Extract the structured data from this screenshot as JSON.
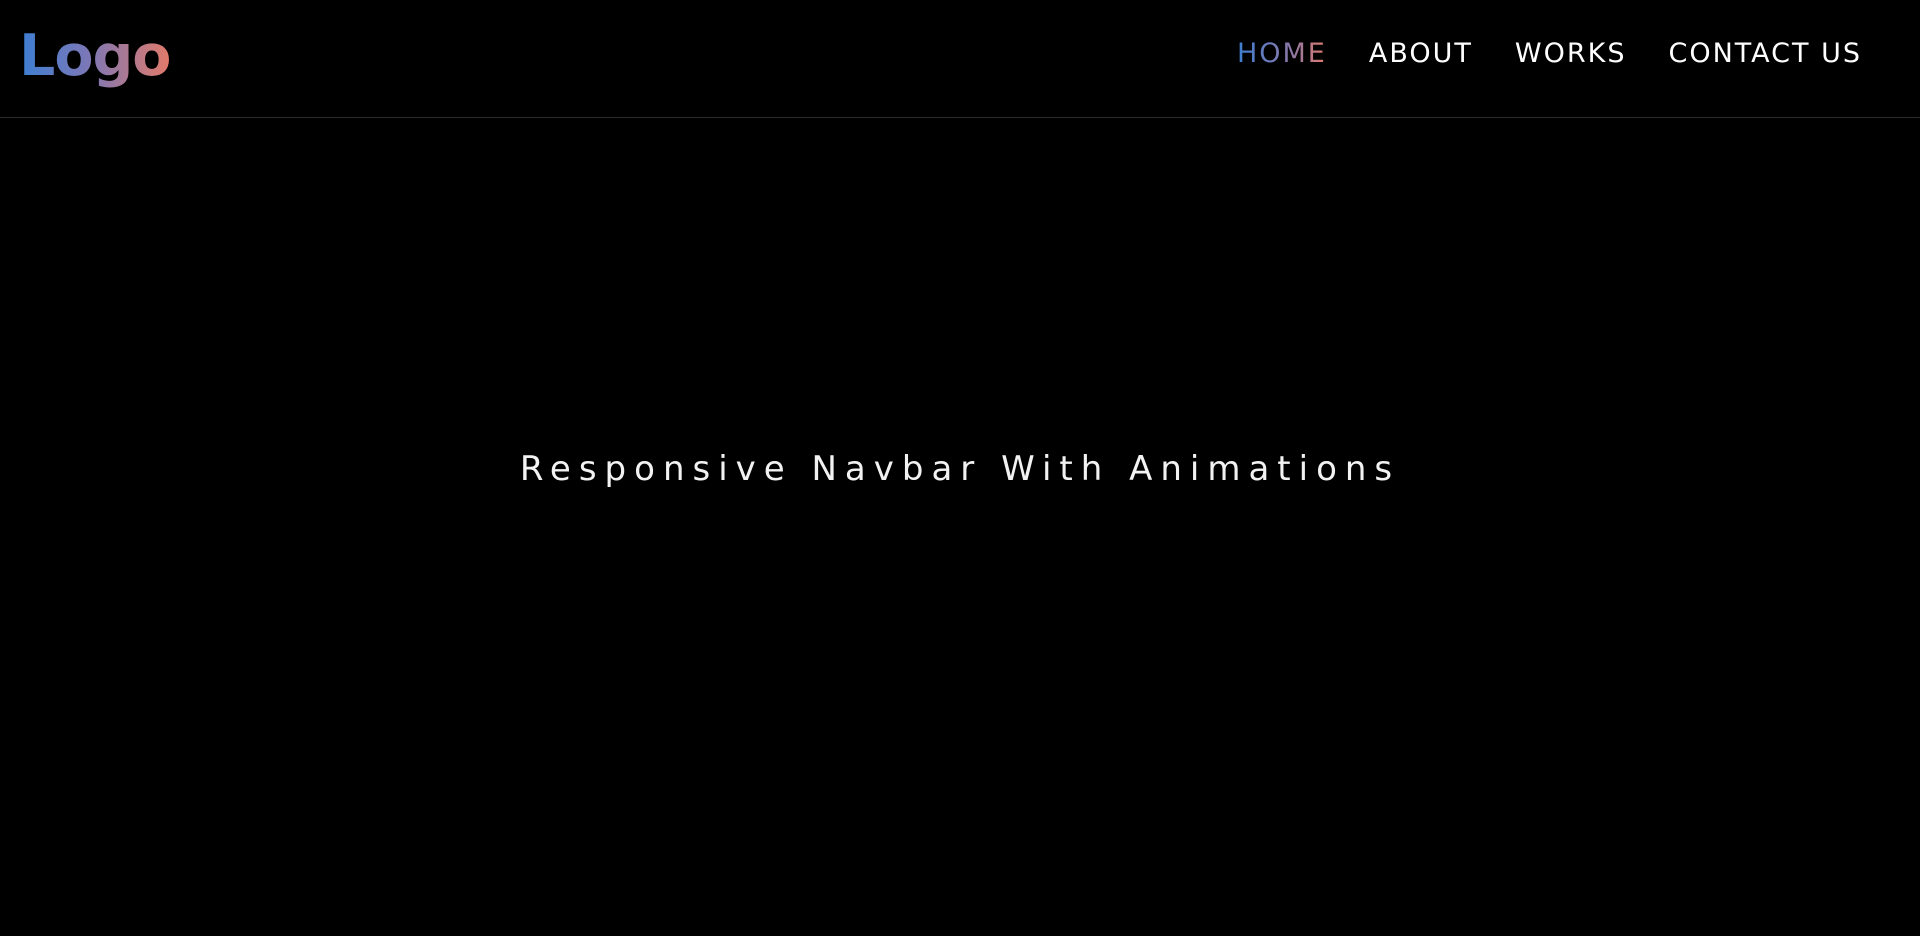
{
  "logo": {
    "text": "Logo"
  },
  "nav": {
    "items": [
      {
        "label": "HOME",
        "active": true
      },
      {
        "label": "ABOUT",
        "active": false
      },
      {
        "label": "WORKS",
        "active": false
      },
      {
        "label": "CONTACT US",
        "active": false
      }
    ]
  },
  "hero": {
    "title": "Responsive Navbar With Animations"
  },
  "colors": {
    "background": "#000000",
    "text": "#ffffff",
    "gradient_start": "#3d7ed2",
    "gradient_end": "#e27a6a",
    "divider": "#2b2b2b"
  }
}
